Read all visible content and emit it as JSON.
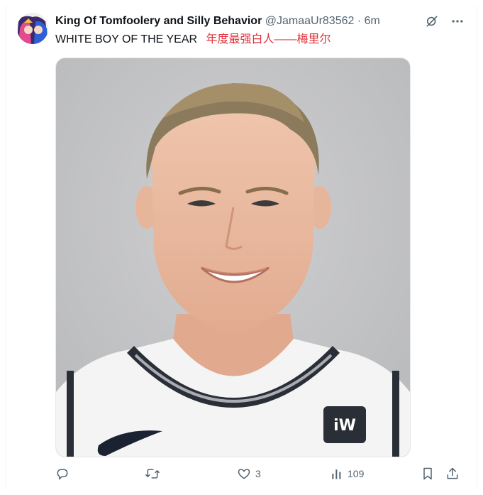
{
  "tweet": {
    "author_name": "King Of Tomfoolery and Silly Behavior",
    "author_handle": "@JamaaUr83562",
    "separator": "·",
    "timestamp": "6m",
    "text": "WHITE BOY OF THE YEAR",
    "translation": "年度最强白人——梅里尔",
    "media_alt": "headshot photo of basketball player in white jersey"
  },
  "actions": {
    "reply_count": "",
    "retweet_count": "",
    "like_count": "3",
    "view_count": "109"
  },
  "icons": {
    "header": [
      "grok-icon",
      "more-icon"
    ],
    "actions": [
      "reply-icon",
      "retweet-icon",
      "like-icon",
      "views-icon",
      "bookmark-icon",
      "share-icon"
    ]
  },
  "colors": {
    "text_primary": "#0f1419",
    "text_secondary": "#536471",
    "translation_text": "#e0323a",
    "photo_background": "#c7c8ca"
  }
}
